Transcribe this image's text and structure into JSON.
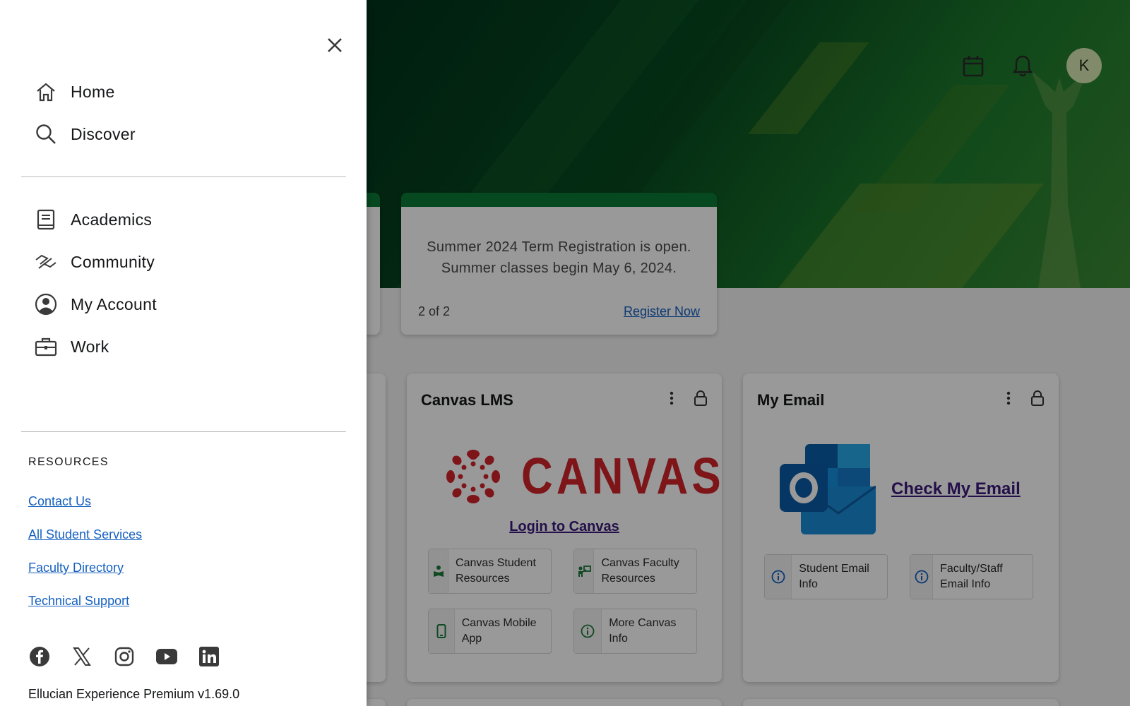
{
  "header": {
    "avatar_initial": "K",
    "calendar_icon": "calendar-icon",
    "notifications_icon": "bell-icon"
  },
  "announcement": {
    "text": "Summer 2024 Term Registration is open. Summer classes begin May 6, 2024.",
    "pager": "2 of 2",
    "action_label": "Register Now"
  },
  "canvas_card": {
    "title": "Canvas LMS",
    "logo_text": "CANVAS",
    "login_label": "Login to Canvas",
    "buttons": [
      {
        "label": "Canvas Student Resources",
        "icon": "reader-icon"
      },
      {
        "label": "Canvas Faculty Resources",
        "icon": "teacher-icon"
      },
      {
        "label": "Canvas Mobile App",
        "icon": "phone-icon"
      },
      {
        "label": "More Canvas Info",
        "icon": "info-icon"
      }
    ]
  },
  "email_card": {
    "title": "My Email",
    "link_label": "Check My Email",
    "buttons": [
      {
        "label": "Student Email Info",
        "icon": "info-icon"
      },
      {
        "label": "Faculty/Staff Email Info",
        "icon": "info-icon"
      }
    ]
  },
  "drawer": {
    "primary": [
      {
        "label": "Home",
        "icon": "home-icon"
      },
      {
        "label": "Discover",
        "icon": "search-icon"
      }
    ],
    "sections": [
      {
        "label": "Academics",
        "icon": "book-icon"
      },
      {
        "label": "Community",
        "icon": "handshake-icon"
      },
      {
        "label": "My Account",
        "icon": "account-circle-icon"
      },
      {
        "label": "Work",
        "icon": "briefcase-icon"
      }
    ],
    "resources_heading": "RESOURCES",
    "resources": [
      "Contact Us",
      "All Student Services",
      "Faculty Directory",
      "Technical Support"
    ],
    "social": [
      "facebook-icon",
      "x-icon",
      "instagram-icon",
      "youtube-icon",
      "linkedin-icon"
    ],
    "version": "Ellucian Experience Premium v1.69.0"
  },
  "colors": {
    "accent_green": "#0a7a36",
    "canvas_red": "#d0232b",
    "link_blue": "#1560c0",
    "visited_purple": "#3b1a7a"
  }
}
